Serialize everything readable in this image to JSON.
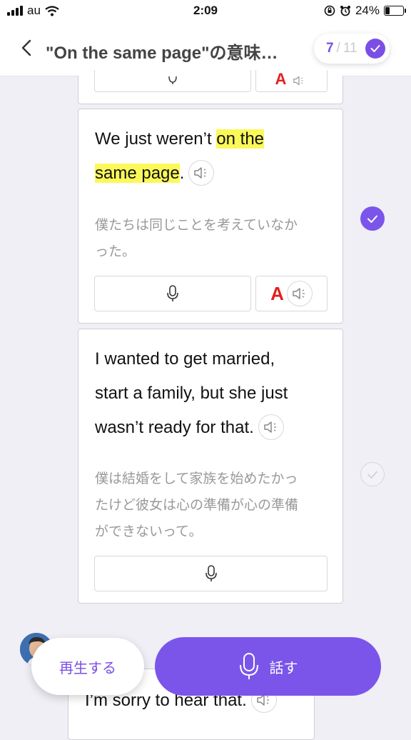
{
  "status_bar": {
    "carrier": "au",
    "time": "2:09",
    "battery": "24%"
  },
  "header": {
    "title": "\"On the same page\"の意味…",
    "progress_current": "7",
    "progress_separator": "/",
    "progress_total": "11"
  },
  "cards": [
    {
      "en_before": "We just weren’t ",
      "en_highlight_1": "on the",
      "en_highlight_2": "same page",
      "en_after": ".",
      "jp_line1": "僕たちは同じことを考えていなか",
      "jp_line2": "った。",
      "checked": true
    },
    {
      "en_line1": "I wanted to get married,",
      "en_line2": "start a family, but she just",
      "en_line3": "wasn’t ready for that.",
      "jp_line1": "僕は結婚をして家族を始めたかっ",
      "jp_line2": "たけど彼女は心の準備が心の準備",
      "jp_line3": "ができないって。",
      "checked": false
    },
    {
      "en_line1": "I’m sorry to hear that."
    }
  ],
  "font_button_label": "A",
  "actions": {
    "play_label": "再生する",
    "speak_label": "話す"
  },
  "colors": {
    "accent": "#7b4fe6",
    "highlight": "#fbf85a",
    "font_A": "#e02020"
  },
  "icons": [
    "back-icon",
    "check-icon",
    "speaker-icon",
    "mic-icon",
    "font-icon"
  ]
}
